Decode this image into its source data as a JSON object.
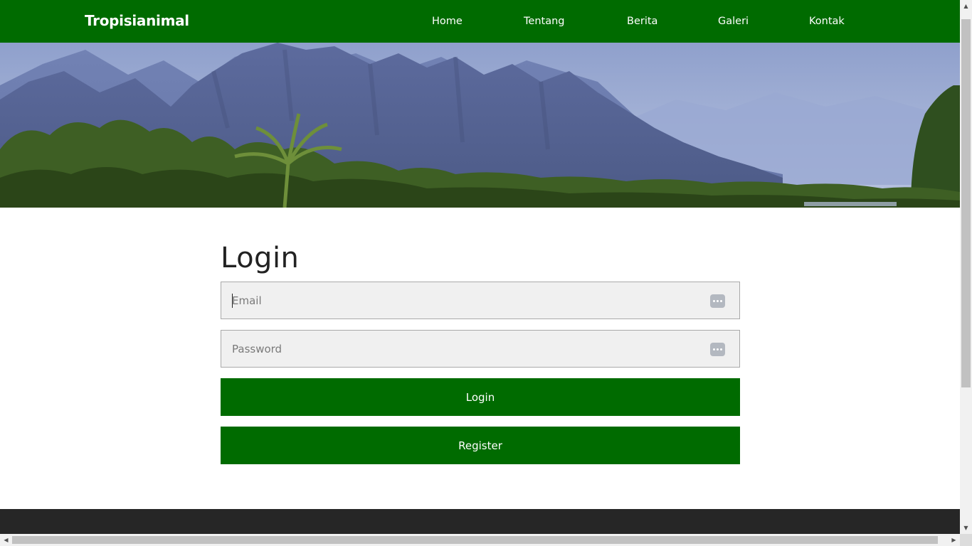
{
  "brand": "Tropisianimal",
  "nav": {
    "home": "Home",
    "about": "Tentang",
    "news": "Berita",
    "gallery": "Galeri",
    "contact": "Kontak"
  },
  "login": {
    "title": "Login",
    "email_placeholder": "Email",
    "email_value": "",
    "password_placeholder": "Password",
    "password_value": "",
    "login_label": "Login",
    "register_label": "Register"
  },
  "icons": {
    "field_icon": "password-manager-icon",
    "scroll_up": "triangle-up-icon",
    "scroll_down": "triangle-down-icon",
    "scroll_left": "triangle-left-icon",
    "scroll_right": "triangle-right-icon"
  },
  "colors": {
    "primary": "#006b00",
    "footer": "#262626",
    "field_bg": "#f0f0f0"
  }
}
